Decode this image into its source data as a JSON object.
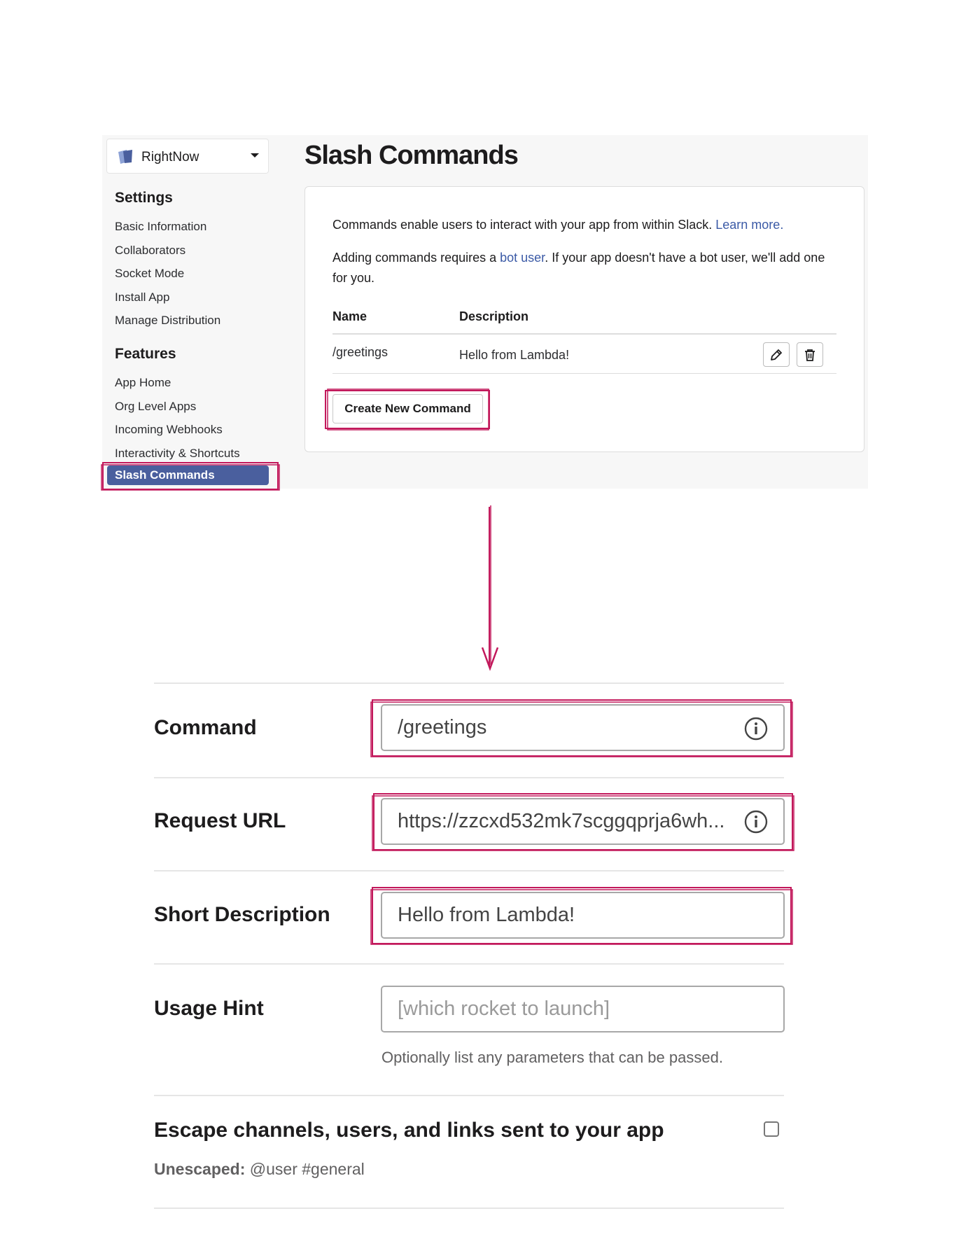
{
  "app_selector": {
    "name": "RightNow"
  },
  "sidebar": {
    "settings_heading": "Settings",
    "settings_items": [
      {
        "label": "Basic Information"
      },
      {
        "label": "Collaborators"
      },
      {
        "label": "Socket Mode"
      },
      {
        "label": "Install App"
      },
      {
        "label": "Manage Distribution"
      }
    ],
    "features_heading": "Features",
    "features_items": [
      {
        "label": "App Home"
      },
      {
        "label": "Org Level Apps"
      },
      {
        "label": "Incoming Webhooks"
      },
      {
        "label": "Interactivity & Shortcuts"
      },
      {
        "label": "Slash Commands"
      }
    ]
  },
  "main": {
    "title": "Slash Commands",
    "intro": {
      "text": "Commands enable users to interact with your app from within Slack.",
      "link": "Learn more."
    },
    "bot_note": {
      "before": "Adding commands requires a",
      "link": "bot user",
      "after": ". If your app doesn't have a bot user, we'll add one for you."
    },
    "table": {
      "columns": [
        "Name",
        "Description"
      ],
      "rows": [
        {
          "name": "/greetings",
          "description": "Hello from Lambda!"
        }
      ]
    },
    "create_button": "Create New Command"
  },
  "form": {
    "command": {
      "label": "Command",
      "value": "/greetings"
    },
    "request_url": {
      "label": "Request URL",
      "value": "https://zzcxd532mk7scggqprja6wh..."
    },
    "short_description": {
      "label": "Short Description",
      "value": "Hello from Lambda!"
    },
    "usage_hint": {
      "label": "Usage Hint",
      "placeholder": "[which rocket to launch]",
      "hint": "Optionally list any parameters that can be passed."
    },
    "escape": {
      "label": "Escape channels, users, and links sent to your app",
      "checked": false,
      "unescaped_label": "Unescaped:",
      "unescaped_example": "@user #general"
    }
  },
  "colors": {
    "highlight": "#c2185b",
    "sidebar_active": "#4a5f9e",
    "link": "#3b5aa6"
  }
}
